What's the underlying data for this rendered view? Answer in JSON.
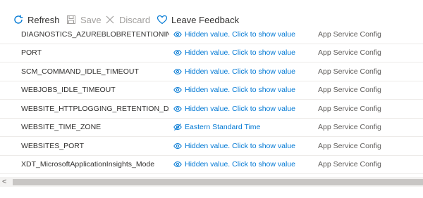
{
  "toolbar": {
    "refresh_label": "Refresh",
    "save_label": "Save",
    "discard_label": "Discard",
    "feedback_label": "Leave Feedback"
  },
  "colors": {
    "accent": "#0078d4",
    "disabled": "#a19f9d",
    "text": "#323130"
  },
  "rows": [
    {
      "name": "DIAGNOSTICS_AZUREBLOBRETENTIONINDA",
      "value": "Hidden value. Click to show value",
      "value_icon": "eye-icon",
      "source": "App Service Config"
    },
    {
      "name": "PORT",
      "value": "Hidden value. Click to show value",
      "value_icon": "eye-icon",
      "source": "App Service Config"
    },
    {
      "name": "SCM_COMMAND_IDLE_TIMEOUT",
      "value": "Hidden value. Click to show value",
      "value_icon": "eye-icon",
      "source": "App Service Config"
    },
    {
      "name": "WEBJOBS_IDLE_TIMEOUT",
      "value": "Hidden value. Click to show value",
      "value_icon": "eye-icon",
      "source": "App Service Config"
    },
    {
      "name": "WEBSITE_HTTPLOGGING_RETENTION_DAYS",
      "value": "Hidden value. Click to show value",
      "value_icon": "eye-icon",
      "source": "App Service Config"
    },
    {
      "name": "WEBSITE_TIME_ZONE",
      "value": "Eastern Standard Time",
      "value_icon": "eye-slash-icon",
      "source": "App Service Config"
    },
    {
      "name": "WEBSITES_PORT",
      "value": "Hidden value. Click to show value",
      "value_icon": "eye-icon",
      "source": "App Service Config"
    },
    {
      "name": "XDT_MicrosoftApplicationInsights_Mode",
      "value": "Hidden value. Click to show value",
      "value_icon": "eye-icon",
      "source": "App Service Config"
    }
  ],
  "scrollbar": {
    "left_arrow": "<"
  }
}
